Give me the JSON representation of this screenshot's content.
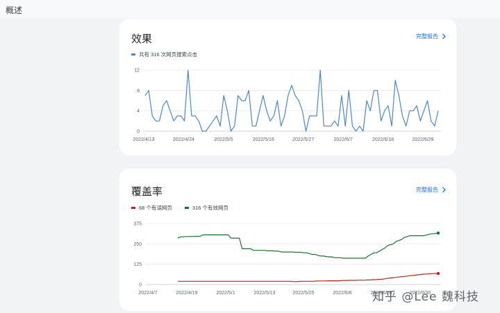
{
  "page": {
    "title": "概述"
  },
  "performance": {
    "title": "效果",
    "report_link": "完整报告",
    "chart_data": {
      "type": "line",
      "title": "效果",
      "series": [
        {
          "name": "共有 316 次网页搜索点击",
          "color": "#4a86c8",
          "values": [
            7,
            8,
            3,
            2,
            2,
            5,
            6,
            4,
            2,
            3,
            3,
            2,
            12,
            3,
            3,
            2,
            0,
            0,
            1,
            2,
            3,
            1,
            7,
            4,
            0,
            1,
            7,
            6,
            6,
            8,
            1,
            1,
            4,
            7,
            4,
            2,
            3,
            6,
            1,
            3,
            7,
            9,
            7,
            6,
            4,
            0,
            3,
            3,
            3,
            12,
            1,
            1,
            1,
            2,
            1,
            7,
            1,
            8,
            1,
            0,
            1,
            0,
            6,
            4,
            8,
            8,
            2,
            4,
            5,
            1,
            10,
            7,
            3,
            1,
            4,
            4,
            5,
            2,
            4,
            6,
            2,
            1,
            4
          ]
        }
      ],
      "x_tick_labels": [
        "2022/4/13",
        "2022/4/24",
        "2022/5/5",
        "2022/5/16",
        "2022/5/27",
        "2022/6/7",
        "2022/6/18",
        "2022/6/29"
      ],
      "y_ticks": [
        0,
        4,
        8,
        12
      ],
      "ylim": [
        0,
        12
      ],
      "grid": true
    }
  },
  "coverage": {
    "title": "覆盖率",
    "report_link": "完整报告",
    "chart_data": {
      "type": "line",
      "title": "覆盖率",
      "series": [
        {
          "name": "68 个有误网页",
          "color": "#b3261e",
          "values": [
            20,
            20,
            20,
            20,
            20,
            20,
            20,
            20,
            20,
            20,
            20,
            20,
            20,
            20,
            20,
            20,
            20,
            20,
            20,
            20,
            20,
            20,
            20,
            20,
            20,
            20,
            20,
            20,
            20,
            20,
            20,
            20,
            20,
            20,
            20,
            20,
            20,
            20,
            20,
            20,
            20,
            18,
            18,
            19,
            20,
            20,
            20,
            20,
            20,
            22,
            22,
            22,
            22,
            23,
            23,
            23,
            23,
            23,
            25,
            25,
            25,
            26,
            26,
            26,
            27,
            27,
            27,
            28,
            28,
            30,
            30,
            32,
            32,
            35,
            38,
            40,
            42,
            44,
            46,
            48,
            50,
            52,
            54,
            56,
            58,
            60,
            62,
            64,
            65,
            66,
            67,
            68,
            68
          ]
        },
        {
          "name": "316 个有效网页",
          "color": "#137333",
          "values": [
            285,
            293,
            293,
            295,
            295,
            295,
            296,
            296,
            296,
            305,
            305,
            305,
            305,
            305,
            305,
            305,
            305,
            305,
            305,
            285,
            285,
            285,
            285,
            220,
            220,
            220,
            220,
            210,
            210,
            210,
            210,
            210,
            207,
            207,
            207,
            205,
            205,
            200,
            200,
            200,
            200,
            200,
            198,
            198,
            198,
            195,
            195,
            190,
            185,
            185,
            180,
            175,
            175,
            172,
            170,
            170,
            165,
            165,
            165,
            162,
            162,
            162,
            162,
            162,
            162,
            162,
            162,
            162,
            175,
            185,
            195,
            195,
            205,
            215,
            225,
            240,
            245,
            250,
            265,
            270,
            278,
            290,
            295,
            300,
            300,
            300,
            300,
            300,
            300,
            305,
            310,
            312,
            314,
            316
          ]
        }
      ],
      "x_tick_labels": [
        "2022/4/7",
        "2022/4/19",
        "2022/5/1",
        "2022/5/13",
        "2022/5/25",
        "2022/6/6",
        "2022/6/18",
        "2022/6/30"
      ],
      "y_ticks": [
        0,
        125,
        250,
        375
      ],
      "ylim": [
        0,
        375
      ],
      "grid": true
    }
  },
  "watermark": "知乎 @Lee 魏科技"
}
